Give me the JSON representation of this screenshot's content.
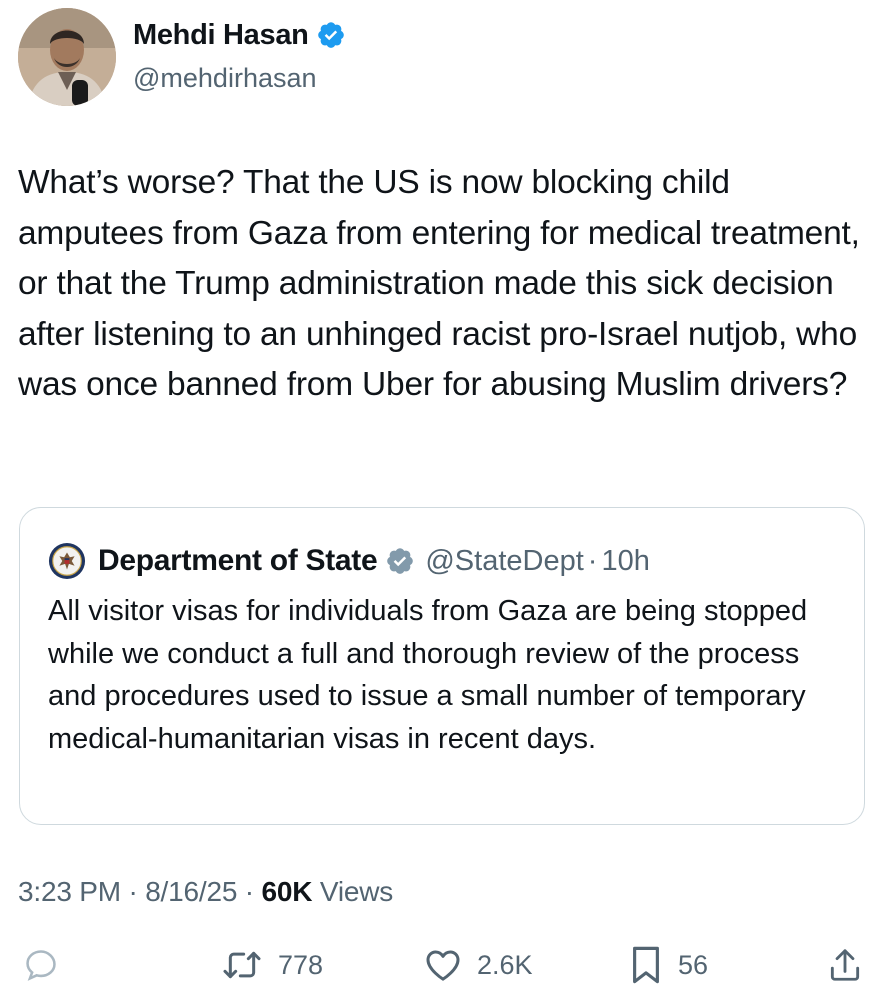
{
  "author": {
    "name": "Mehdi Hasan",
    "handle": "@mehdirhasan",
    "verified": true,
    "avatar_icon": "profile-photo"
  },
  "tweet": {
    "text": "What’s worse? That the US is now blocking child amputees from Gaza from entering for medical treatment, or that the Trump administration made this sick decision after listening to an unhinged racist pro-Israel nutjob, who was once banned from Uber for abusing Muslim drivers?"
  },
  "quote": {
    "name": "Department of State",
    "handle": "@StateDept",
    "separator": "·",
    "time": "10h",
    "verified_color": "#829aab",
    "avatar_icon": "state-department-seal",
    "text": "All visitor visas for individuals from Gaza are being stopped while we conduct a full and thorough review of the process and procedures used to issue a small number of temporary medical-humanitarian visas in recent days."
  },
  "meta": {
    "time": "3:23 PM",
    "sep1": " · ",
    "date": "8/16/25",
    "sep2": " · ",
    "views_count": "60K",
    "views_label": " Views"
  },
  "actions": {
    "reply_icon": "reply-icon",
    "retweets": "778",
    "likes": "2.6K",
    "bookmarks": "56",
    "share_icon": "share-icon"
  },
  "colors": {
    "verified_blue": "#1d9bf0",
    "text": "#0f1419",
    "secondary": "#536471",
    "border": "#cfd9de"
  }
}
